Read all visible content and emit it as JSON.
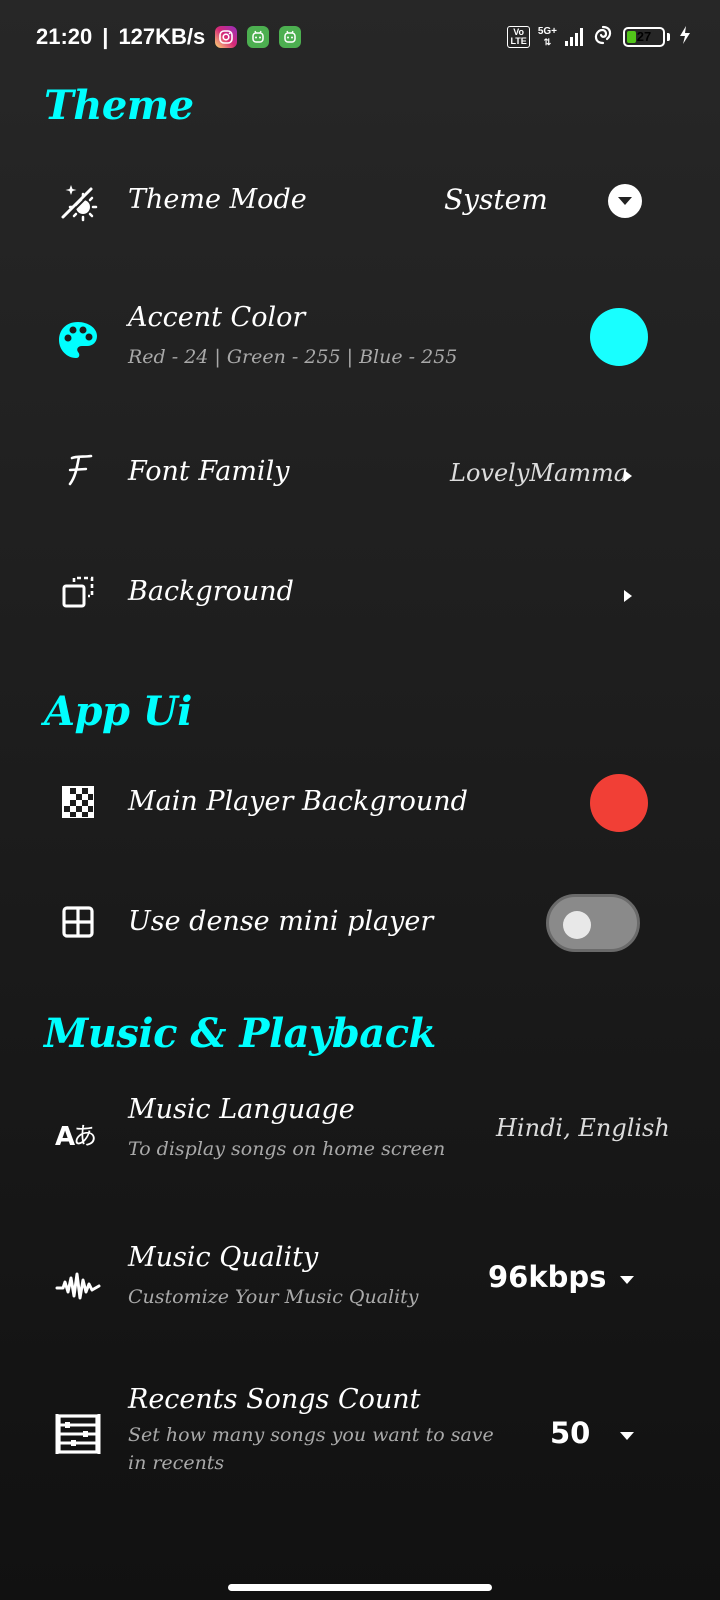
{
  "status_bar": {
    "time": "21:20",
    "separator": "|",
    "speed": "127KB/s",
    "volte": "Vo\nLTE",
    "network": "5G+",
    "battery": "27",
    "battery_level_percent": 27,
    "colors": {
      "battery_fill": "#52c41a",
      "instagram": "#d6249f",
      "app_green": "#4caf50"
    }
  },
  "sections": {
    "theme": {
      "title": "Theme",
      "theme_mode": {
        "label": "Theme Mode",
        "value": "System",
        "icon": "theme-mode-icon"
      },
      "accent_color": {
        "label": "Accent Color",
        "subtitle": "Red - 24 | Green - 255 | Blue - 255",
        "icon": "palette-icon",
        "color": "#18ffff"
      },
      "font_family": {
        "label": "Font Family",
        "value": "LovelyMamma",
        "icon": "font-icon"
      },
      "background": {
        "label": "Background",
        "icon": "background-icon"
      }
    },
    "app_ui": {
      "title": "App Ui",
      "main_player_background": {
        "label": "Main Player Background",
        "icon": "checkerboard-icon",
        "color": "#f13f36"
      },
      "dense_mini_player": {
        "label": "Use dense mini player",
        "icon": "grid-icon",
        "enabled": false
      }
    },
    "music_playback": {
      "title": "Music & Playback",
      "music_language": {
        "label": "Music Language",
        "subtitle": "To display songs on home screen",
        "value": "Hindi, English",
        "icon": "language-icon"
      },
      "music_quality": {
        "label": "Music Quality",
        "subtitle": "Customize Your Music Quality",
        "value": "96kbps",
        "icon": "waveform-icon"
      },
      "recents_count": {
        "label": "Recents Songs Count",
        "subtitle_line1": "Set how many songs you want to save",
        "subtitle_line2": "in recents",
        "value": "50",
        "icon": "abacus-icon"
      }
    }
  },
  "colors": {
    "accent": "#00ffff",
    "background": "#1c1c1c"
  }
}
